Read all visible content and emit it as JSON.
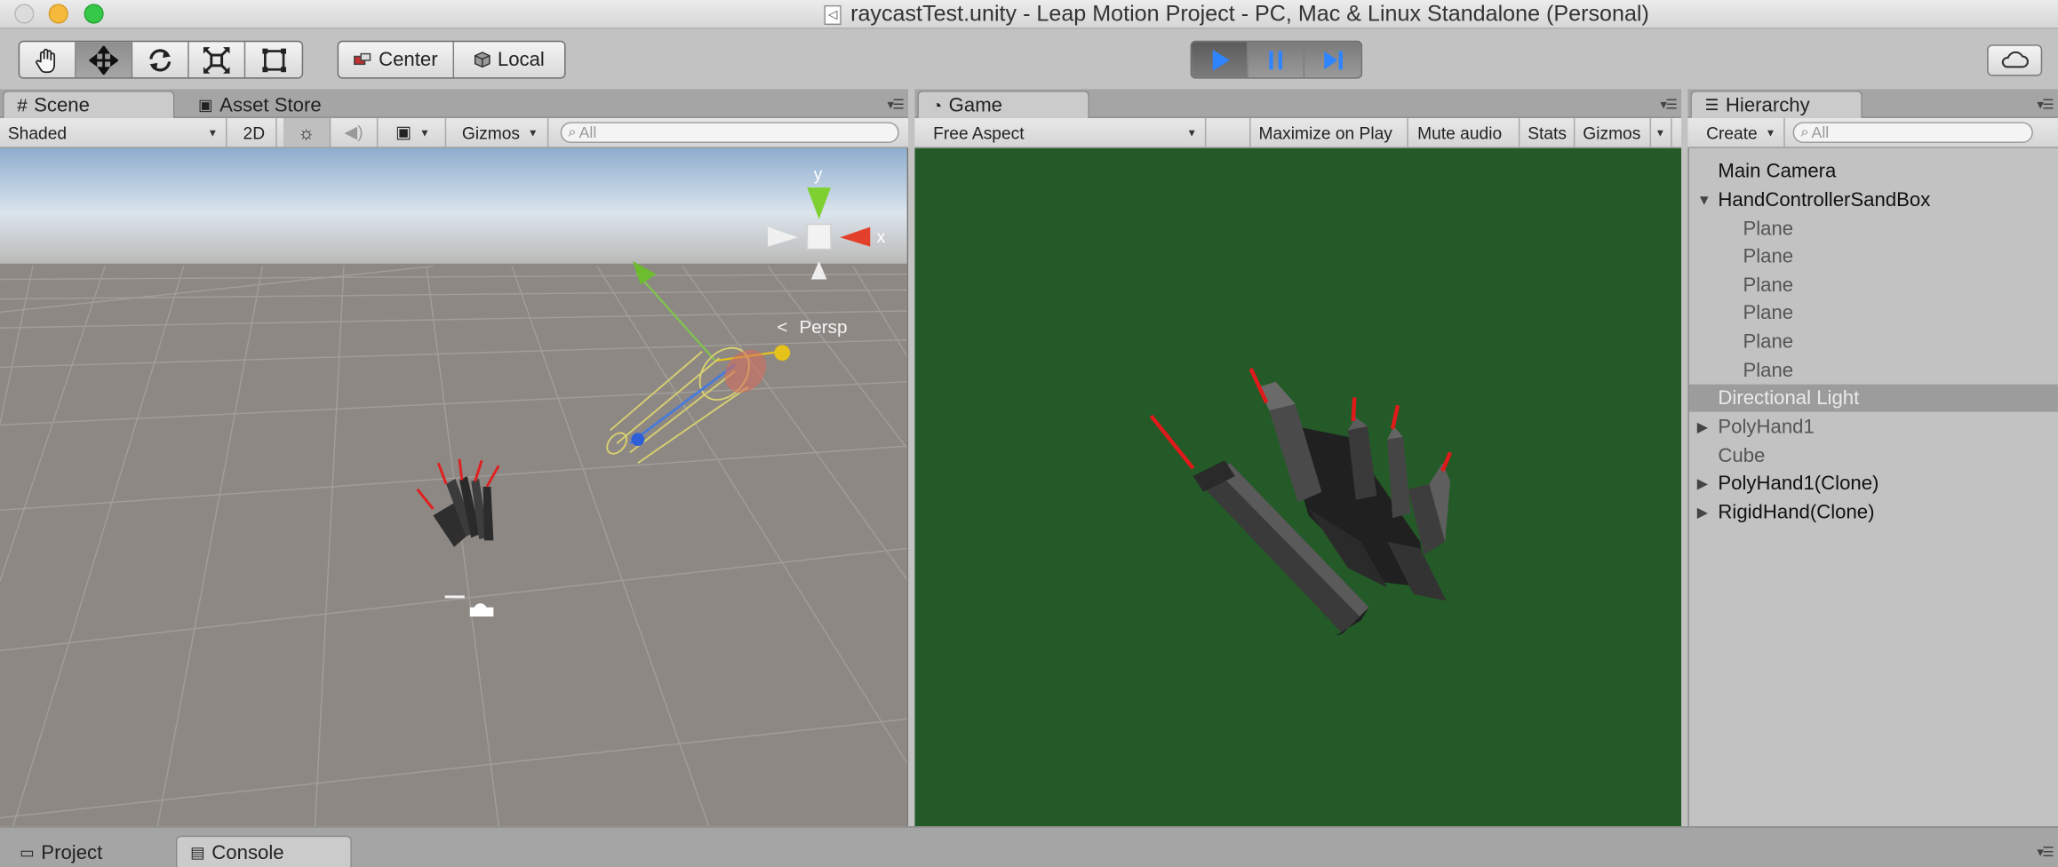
{
  "window": {
    "title": "raycastTest.unity - Leap Motion Project - PC, Mac & Linux Standalone (Personal)"
  },
  "toolbar": {
    "tools": [
      "hand-icon",
      "move-icon",
      "rotate-icon",
      "scale-icon",
      "rect-icon"
    ],
    "active_tool": "move-icon",
    "pivot_label": "Center",
    "space_label": "Local",
    "play_controls": [
      "play-icon",
      "pause-icon",
      "step-icon"
    ],
    "cloud": "cloud-icon"
  },
  "scene": {
    "tab_label": "Scene",
    "asset_store_label": "Asset Store",
    "shading_mode": "Shaded",
    "mode_2d": "2D",
    "gizmos_label": "Gizmos",
    "search_placeholder": "All",
    "persp_label": "Persp",
    "axis_y": "y",
    "axis_x": "x",
    "sky_color": "#a9c1dc",
    "ground_color": "#8f8a86"
  },
  "game": {
    "tab_label": "Game",
    "aspect": "Free Aspect",
    "maximize": "Maximize on Play",
    "mute": "Mute audio",
    "stats": "Stats",
    "gizmos": "Gizmos",
    "background_color": "#245a27"
  },
  "hierarchy": {
    "tab_label": "Hierarchy",
    "create_label": "Create",
    "search_placeholder": "All",
    "items": [
      {
        "label": "Main Camera"
      },
      {
        "label": "HandControllerSandBox"
      },
      {
        "label": "Plane"
      },
      {
        "label": "Plane"
      },
      {
        "label": "Plane"
      },
      {
        "label": "Plane"
      },
      {
        "label": "Plane"
      },
      {
        "label": "Plane"
      },
      {
        "label": "Directional Light"
      },
      {
        "label": "PolyHand1"
      },
      {
        "label": "Cube"
      },
      {
        "label": "PolyHand1(Clone)"
      },
      {
        "label": "RigidHand(Clone)"
      }
    ]
  },
  "bottom": {
    "project_label": "Project",
    "console_label": "Console"
  }
}
